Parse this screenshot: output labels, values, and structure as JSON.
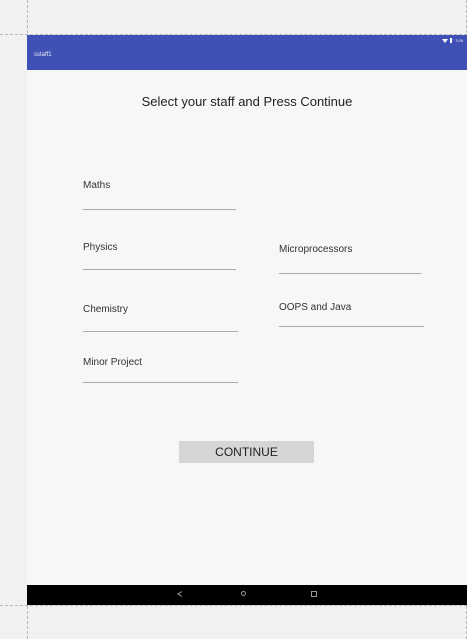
{
  "app": {
    "title": "sstaff1",
    "status_time": "7:09"
  },
  "heading": "Select your staff and Press Continue",
  "subjects": {
    "maths": "Maths",
    "physics": "Physics",
    "chemistry": "Chemistry",
    "minor_project": "Minor Project",
    "microprocessors": "Microprocessors",
    "oops_java": "OOPS and Java"
  },
  "continue_label": "CONTINUE"
}
